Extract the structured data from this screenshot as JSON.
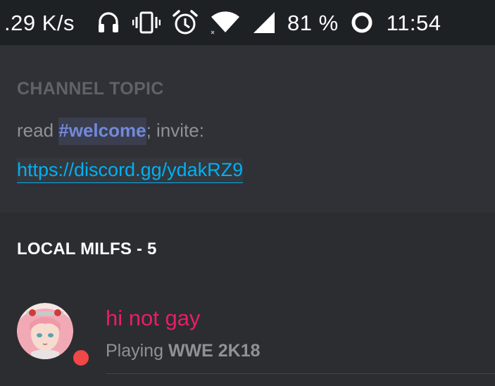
{
  "status_bar": {
    "net_speed": ".29 K/s",
    "battery": "81 %",
    "time": "11:54",
    "icons": [
      "headphones-icon",
      "vibrate-icon",
      "alarm-icon",
      "wifi-icon",
      "signal-icon",
      "battery-ring-icon"
    ]
  },
  "topic": {
    "heading": "CHANNEL TOPIC",
    "prefix": "read ",
    "channel_mention": "#welcome",
    "suffix": "; invite:",
    "link": "https://discord.gg/ydakRZ9"
  },
  "members": {
    "role_header": "LOCAL MILFS - 5",
    "items": [
      {
        "name": "hi not gay",
        "activity_prefix": "Playing ",
        "activity_game": "WWE 2K18",
        "status": "dnd",
        "name_color": "#e91e63",
        "status_color": "#f04747"
      }
    ]
  },
  "colors": {
    "background": "#2f3136",
    "mention": "#7289da",
    "link": "#00b0f4"
  }
}
